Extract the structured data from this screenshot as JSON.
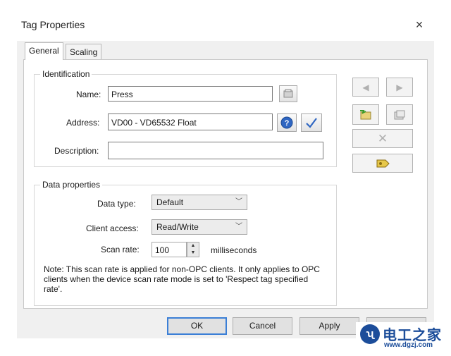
{
  "window": {
    "title": "Tag Properties",
    "close_glyph": "×"
  },
  "tabs": [
    {
      "label": "General",
      "active": true
    },
    {
      "label": "Scaling",
      "active": false
    }
  ],
  "identification": {
    "group_title": "Identification",
    "name_label": "Name:",
    "name_value": "Press",
    "address_label": "Address:",
    "address_value": "VD00 - VD65532 Float",
    "description_label": "Description:",
    "description_value": ""
  },
  "data_properties": {
    "group_title": "Data properties",
    "data_type_label": "Data type:",
    "data_type_value": "Default",
    "client_access_label": "Client access:",
    "client_access_value": "Read/Write",
    "scan_rate_label": "Scan rate:",
    "scan_rate_value": "100",
    "scan_rate_unit": "milliseconds",
    "note": "Note: This scan rate is applied for non-OPC clients. It only applies to OPC clients when the device scan rate mode is set to 'Respect tag specified rate'."
  },
  "buttons": {
    "ok": "OK",
    "cancel": "Cancel",
    "apply": "Apply"
  },
  "watermark": {
    "logo": "ʯ",
    "main": "电工之家",
    "sub": "www.dgzj.com"
  },
  "colors": {
    "accent": "#3b7fd6",
    "watermark": "#1c4d9a"
  }
}
